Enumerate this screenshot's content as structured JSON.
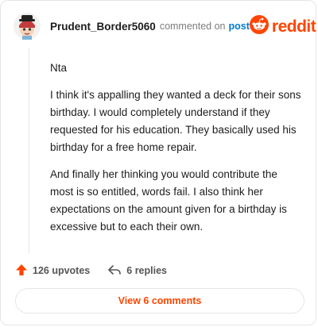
{
  "header": {
    "username": "Prudent_Border5060",
    "commented_text": "commented on",
    "post_link": "post",
    "brand": "reddit"
  },
  "comment": {
    "paragraphs": [
      "Nta",
      "I think it's appalling they wanted a deck for their sons birthday. I would completely understand if they requested for his education. They basically used his birthday for a free home repair.",
      "And finally her thinking you would contribute the most is so entitled, words fail. I also think her expectations on the amount given for a birthday is excessive but to each their own."
    ]
  },
  "footer": {
    "upvotes": "126 upvotes",
    "replies": "6 replies"
  },
  "view_comments": "View 6 comments",
  "colors": {
    "accent": "#ff4500",
    "link": "#0079d3"
  },
  "icons": {
    "upvote": "upvote-arrow-icon",
    "reply": "reply-arrow-icon",
    "brand": "reddit-snoo-icon"
  }
}
